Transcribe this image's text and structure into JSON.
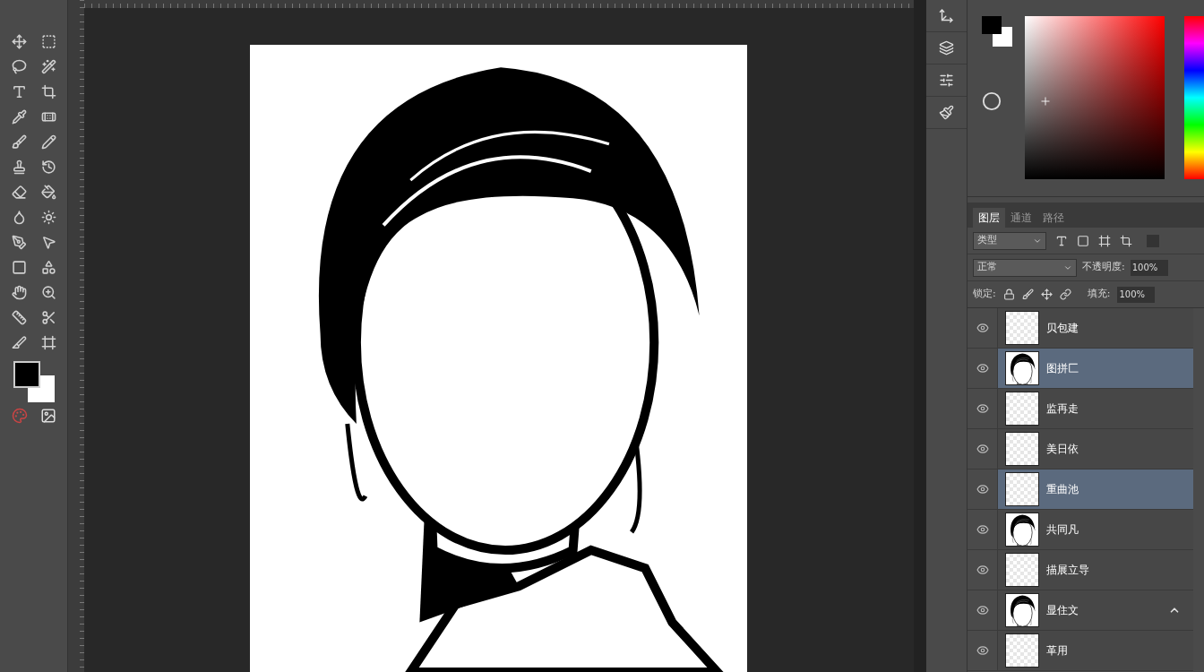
{
  "tabs": [
    {
      "label": "图层",
      "selected": true
    },
    {
      "label": "通道",
      "selected": false
    },
    {
      "label": "路径",
      "selected": false
    }
  ],
  "filter": {
    "value": "类型"
  },
  "blend": {
    "value": "正常",
    "opacity_label": "不透明度:",
    "opacity": "100%"
  },
  "lock": {
    "label": "锁定:",
    "fill_label": "填充:",
    "fill": "100%"
  },
  "layers": [
    {
      "name": "贝包建",
      "kind": "blank",
      "visible": true,
      "selected": false,
      "marked": false
    },
    {
      "name": "图拼匚",
      "kind": "figure",
      "visible": true,
      "selected": true,
      "marked": false
    },
    {
      "name": "监再走",
      "kind": "blank",
      "visible": true,
      "selected": false,
      "marked": false
    },
    {
      "name": "美日依",
      "kind": "blank",
      "visible": true,
      "selected": false,
      "marked": false
    },
    {
      "name": "重曲池",
      "kind": "blank",
      "visible": true,
      "selected": true,
      "marked": false
    },
    {
      "name": "共同凡",
      "kind": "figure",
      "visible": true,
      "selected": false,
      "marked": false
    },
    {
      "name": "描展立导",
      "kind": "blank",
      "visible": true,
      "selected": false,
      "marked": false
    },
    {
      "name": "显住文",
      "kind": "figure",
      "visible": true,
      "selected": false,
      "marked": true
    },
    {
      "name": "革用",
      "kind": "blank",
      "visible": true,
      "selected": false,
      "marked": false
    }
  ]
}
